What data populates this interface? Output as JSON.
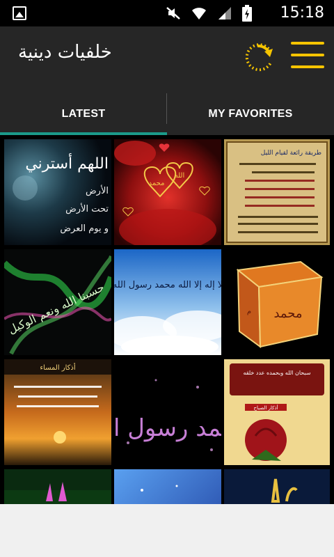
{
  "status_bar": {
    "time": "15:18",
    "icons": [
      "gallery-icon",
      "mute-icon",
      "wifi-icon",
      "signal-icon",
      "battery-icon"
    ]
  },
  "app_bar": {
    "title": "خلفيات دينية",
    "accent_color": "#f5c400",
    "refresh_icon": "refresh-icon",
    "menu_icon": "menu-icon"
  },
  "tabs": {
    "latest": "LATEST",
    "favorites": "MY FAVORITES",
    "selected": "LATEST",
    "indicator_color": "#1b9a8a"
  },
  "wallpapers": [
    {
      "id": "w1",
      "text_lines": [
        "اللهم أسترني",
        "الأرض",
        "تحت الأرض",
        "و يوم العرض"
      ]
    },
    {
      "id": "w2",
      "text_lines": [
        "الله",
        "محمد"
      ]
    },
    {
      "id": "w3",
      "text_lines": [
        "طريقة رائعة لقيام الليل"
      ]
    },
    {
      "id": "w4",
      "text_lines": [
        "حسبنا الله ونعم الوكيل"
      ]
    },
    {
      "id": "w5",
      "text_lines": [
        "لا إله إلا الله محمد رسول الله"
      ]
    },
    {
      "id": "w6",
      "text_lines": [
        "محمد"
      ]
    },
    {
      "id": "w7",
      "text_lines": [
        "أذكار المساء"
      ]
    },
    {
      "id": "w8",
      "text_lines": [
        "محمد رسول الله"
      ]
    },
    {
      "id": "w9",
      "text_lines": [
        "سبحان الله وبحمده عدد خلقه",
        "أذكار الصباح"
      ]
    },
    {
      "id": "w10",
      "text_lines": []
    },
    {
      "id": "w11",
      "text_lines": []
    },
    {
      "id": "w12",
      "text_lines": []
    }
  ]
}
